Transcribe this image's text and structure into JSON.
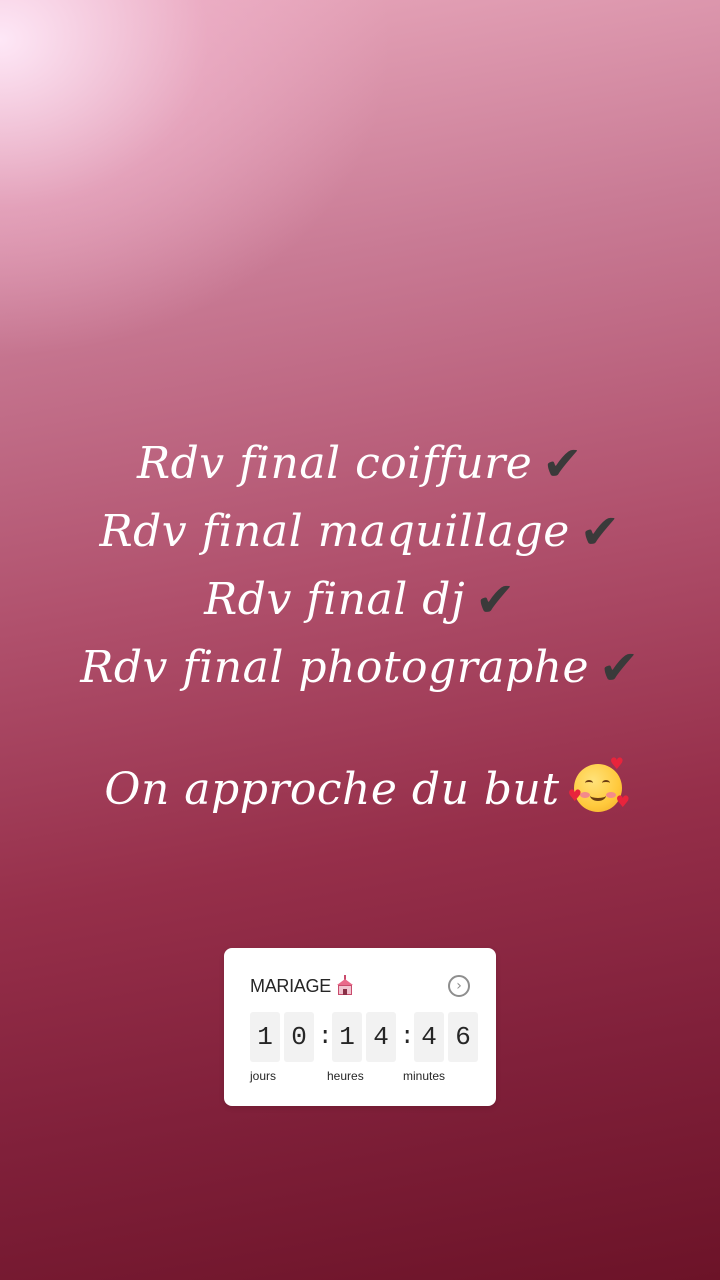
{
  "story": {
    "lines": [
      {
        "text": "Rdv final coiffure",
        "check": "✔"
      },
      {
        "text": "Rdv final maquillage",
        "check": "✔"
      },
      {
        "text": "Rdv final dj",
        "check": "✔"
      },
      {
        "text": "Rdv final photographe",
        "check": "✔"
      }
    ],
    "closing": "On approche du but",
    "closing_emoji": "smiling-face-with-hearts-icon"
  },
  "countdown": {
    "title": "MARIAGE",
    "title_emoji": "wedding-chapel-icon",
    "action_icon": "chevron-right-circle-icon",
    "digits": {
      "d1": "1",
      "d2": "0",
      "h1": "1",
      "h2": "4",
      "m1": "4",
      "m2": "6"
    },
    "separator": ":",
    "labels": {
      "days": "jours",
      "hours": "heures",
      "minutes": "minutes"
    }
  }
}
